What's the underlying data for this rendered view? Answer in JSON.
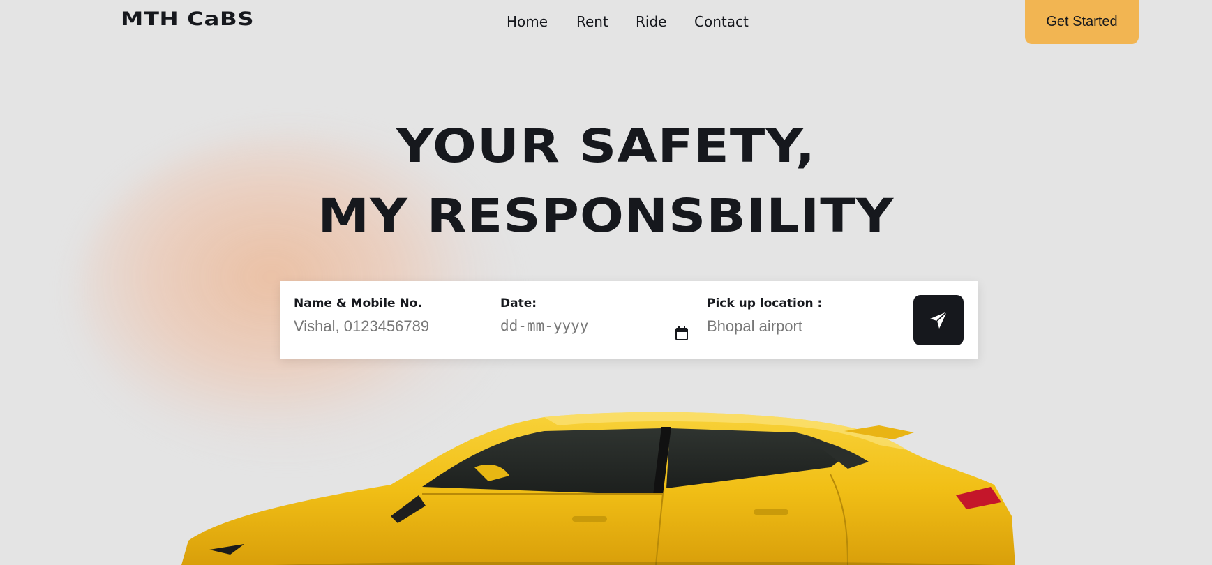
{
  "brand": {
    "logo_text": "MTH CaBS"
  },
  "nav": {
    "items": [
      "Home",
      "Rent",
      "Ride",
      "Contact"
    ],
    "cta_label": "Get Started"
  },
  "hero": {
    "title_line1": "YOUR SAFETY,",
    "title_line2": "MY RESPONSBILITY"
  },
  "booking": {
    "name_label": "Name & Mobile No.",
    "name_placeholder": "Vishal, 0123456789",
    "date_label": "Date:",
    "date_placeholder": "dd-mm-yyyy",
    "pickup_label": "Pick up location :",
    "pickup_placeholder": "Bhopal airport"
  },
  "icons": {
    "date_icon": "calendar-icon",
    "submit_icon": "send-icon"
  },
  "colors": {
    "background": "#e4e4e4",
    "accent": "#f2b552",
    "dark": "#16181d",
    "car_yellow": "#f3c31c"
  }
}
